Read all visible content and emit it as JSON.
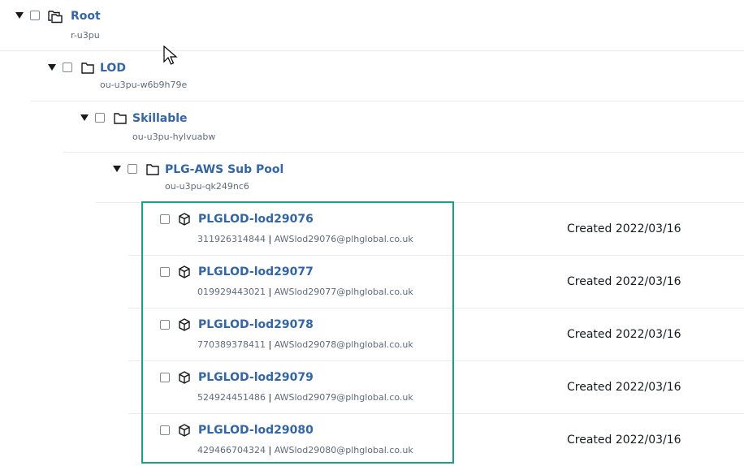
{
  "tree": {
    "root": {
      "name": "Root",
      "id": "r-u3pu"
    },
    "lod": {
      "name": "LOD",
      "id": "ou-u3pu-w6b9h79e"
    },
    "skillable": {
      "name": "Skillable",
      "id": "ou-u3pu-hylvuabw"
    },
    "pool": {
      "name": "PLG-AWS Sub Pool",
      "id": "ou-u3pu-qk249nc6"
    }
  },
  "accounts": [
    {
      "name": "PLGLOD-lod29076",
      "account_id": "311926314844",
      "email": "AWSlod29076@plhglobal.co.uk",
      "created": "Created 2022/03/16"
    },
    {
      "name": "PLGLOD-lod29077",
      "account_id": "019929443021",
      "email": "AWSlod29077@plhglobal.co.uk",
      "created": "Created 2022/03/16"
    },
    {
      "name": "PLGLOD-lod29078",
      "account_id": "770389378411",
      "email": "AWSlod29078@plhglobal.co.uk",
      "created": "Created 2022/03/16"
    },
    {
      "name": "PLGLOD-lod29079",
      "account_id": "524924451486",
      "email": "AWSlod29079@plhglobal.co.uk",
      "created": "Created 2022/03/16"
    },
    {
      "name": "PLGLOD-lod29080",
      "account_id": "429466704324",
      "email": "AWSlod29080@plhglobal.co.uk",
      "created": "Created 2022/03/16"
    }
  ],
  "separator": "|",
  "colors": {
    "link": "#3465a4",
    "highlight": "#1aa382",
    "divider": "#e9ebed"
  }
}
